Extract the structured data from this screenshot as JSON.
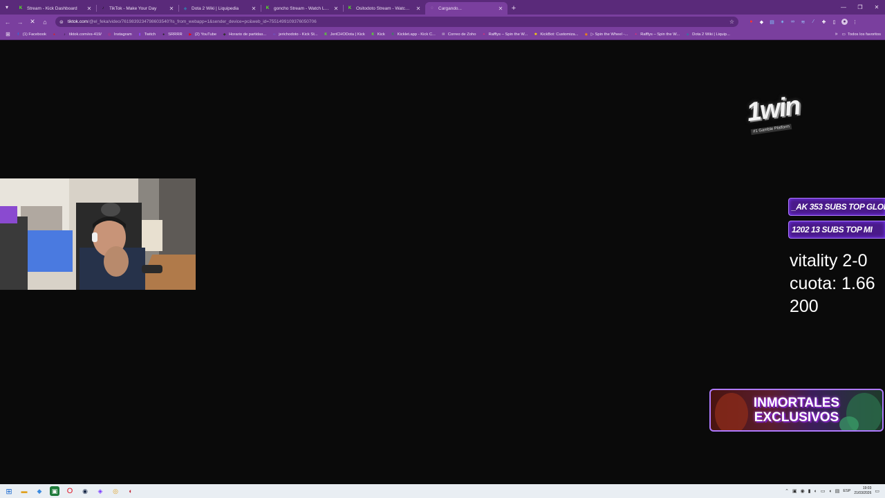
{
  "browser": {
    "tabs": [
      {
        "title": "Stream - Kick Dashboard",
        "icon": "K",
        "icon_color": "#53fc18",
        "active": false
      },
      {
        "title": "TikTok - Make Your Day",
        "icon": "♪",
        "icon_color": "#111111",
        "active": false
      },
      {
        "title": "Dota 2 Wiki | Liquipedia",
        "icon": "◆",
        "icon_color": "#3a6ea5",
        "active": false
      },
      {
        "title": "goncho Stream - Watch Live on Kick",
        "icon": "K",
        "icon_color": "#53fc18",
        "active": false
      },
      {
        "title": "Ositodoto Stream - Watch Live on Kick",
        "icon": "K",
        "icon_color": "#53fc18",
        "active": false
      },
      {
        "title": "Cargando...",
        "icon": "◌",
        "icon_color": "#c9b3da",
        "active": true
      }
    ],
    "url_host": "tiktok.com",
    "url_path": "/@el_feka/video/7619839234798603540?is_from_webapp=1&sender_device=pc&web_id=7551499109376050706",
    "bookmarks": [
      {
        "label": "(1) Facebook",
        "icon": "f",
        "icon_color": "#1877f2"
      },
      {
        "label": "",
        "icon": "●",
        "icon_color": "#e02020"
      },
      {
        "label": "tiktok.com/es-419/",
        "icon": "♪",
        "icon_color": "#111111"
      },
      {
        "label": "Instagram",
        "icon": "◎",
        "icon_color": "#d62976"
      },
      {
        "label": "Twitch",
        "icon": "▮",
        "icon_color": "#9146ff"
      },
      {
        "label": "SRRRR",
        "icon": "●",
        "icon_color": "#222222"
      },
      {
        "label": "(2) YouTube",
        "icon": "▶",
        "icon_color": "#ff0000"
      },
      {
        "label": "Horario de partidas...",
        "icon": "◆",
        "icon_color": "#333333"
      },
      {
        "label": "jerichodoto - Kick St...",
        "icon": "∞",
        "icon_color": "#6a5acd"
      },
      {
        "label": "JeriCHODota | Kick",
        "icon": "K",
        "icon_color": "#53fc18"
      },
      {
        "label": "Kick",
        "icon": "K",
        "icon_color": "#53fc18"
      },
      {
        "label": "Kicklet.app - Kick C...",
        "icon": "K",
        "icon_color": "#2e8b57"
      },
      {
        "label": "Correo de Zoho",
        "icon": "✉",
        "icon_color": "#e0e0e0"
      },
      {
        "label": "Rafflys – Spin the W...",
        "icon": "✦",
        "icon_color": "#e0307a"
      },
      {
        "label": "KickBot: Customiza...",
        "icon": "✱",
        "icon_color": "#ffd700"
      },
      {
        "label": "▷ Spin the Wheel -...",
        "icon": "◉",
        "icon_color": "#ff8c00"
      },
      {
        "label": "Rafflys – Spin the W...",
        "icon": "✦",
        "icon_color": "#e0307a"
      },
      {
        "label": "Dota 2 Wiki | Liquip...",
        "icon": "◆",
        "icon_color": "#3a6ea5"
      }
    ],
    "all_bookmarks_label": "Todos los favoritos"
  },
  "overlay": {
    "logo_text": "1win",
    "logo_tag": "#1 Gamble Platform",
    "sub_banner_1": "_AK 353 SUBS  TOP GLOI",
    "sub_banner_2": "1202 13 SUBS      TOP MI",
    "bet_lines": [
      "vitality 2-0",
      "cuota: 1.66",
      "200"
    ],
    "promo_line_1": "INMORTALES",
    "promo_line_2": "EXCLUSIVOS"
  },
  "taskbar": {
    "lang": "ESP",
    "time": "19:03",
    "date": "21/03/2026"
  },
  "colors": {
    "tabstrip": "#5a2a7a",
    "toolbar": "#7a3f9e",
    "page_bg": "#0a0a0a",
    "banner_purple": "#4a1a8a"
  }
}
